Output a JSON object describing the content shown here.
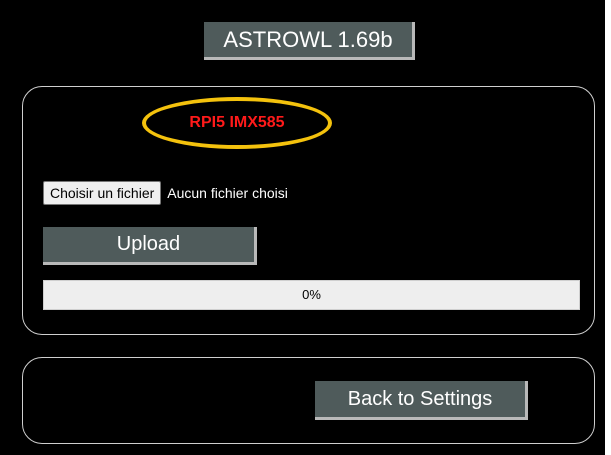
{
  "header": {
    "title": "ASTROWL 1.69b"
  },
  "upload_panel": {
    "device_label": "RPI5 IMX585",
    "file_button_label": "Choisir un fichier",
    "file_status": "Aucun fichier choisi",
    "upload_label": "Upload",
    "progress": {
      "value": 0,
      "text": "0%"
    }
  },
  "nav_panel": {
    "back_label": "Back to Settings"
  },
  "colors": {
    "background": "#000000",
    "button_bg": "#4f5b5b",
    "device_label_text": "#ff1a1a",
    "device_label_ring": "#f4c20d"
  }
}
